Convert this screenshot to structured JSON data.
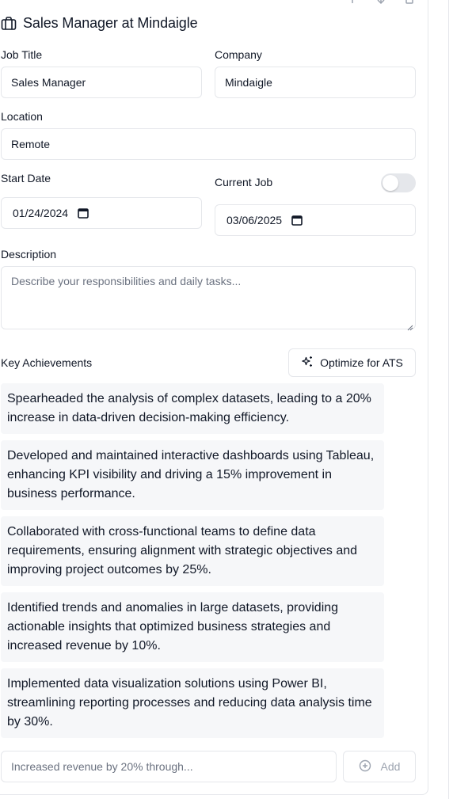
{
  "header": {
    "title": "Sales Manager at Mindaigle"
  },
  "form": {
    "job_title_label": "Job Title",
    "job_title_value": "Sales Manager",
    "company_label": "Company",
    "company_value": "Mindaigle",
    "location_label": "Location",
    "location_value": "Remote",
    "start_date_label": "Start Date",
    "start_date_value": "01/24/2024",
    "current_job_label": "Current Job",
    "end_date_value": "03/06/2025",
    "description_label": "Description",
    "description_placeholder": "Describe your responsibilities and daily tasks..."
  },
  "achievements": {
    "label": "Key Achievements",
    "optimize_label": "Optimize for ATS",
    "items": [
      "Spearheaded the analysis of complex datasets, leading to a 20% increase in data-driven decision-making efficiency.",
      "Developed and maintained interactive dashboards using Tableau, enhancing KPI visibility and driving a 15% improvement in business performance.",
      "Collaborated with cross-functional teams to define data requirements, ensuring alignment with strategic objectives and improving project outcomes by 25%.",
      "Identified trends and anomalies in large datasets, providing actionable insights that optimized business strategies and increased revenue by 10%.",
      "Implemented data visualization solutions using Power BI, streamlining reporting processes and reducing data analysis time by 30%."
    ],
    "add_placeholder": "Increased revenue by 20% through...",
    "add_label": "Add"
  }
}
